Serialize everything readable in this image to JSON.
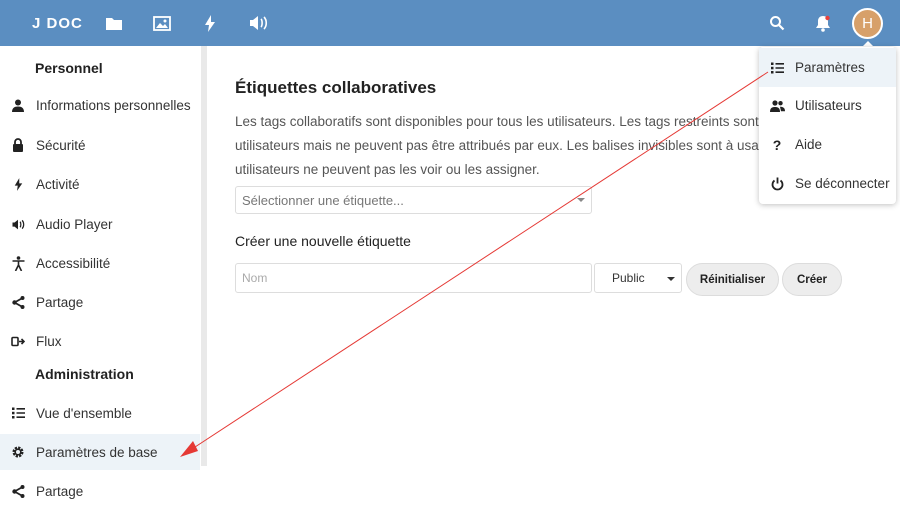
{
  "header": {
    "logo": "J DOC",
    "avatar_letter": "H",
    "icons": [
      "folder-icon",
      "image-icon",
      "bolt-icon",
      "volume-icon",
      "search-icon",
      "bell-icon"
    ]
  },
  "sidebar": {
    "personal_heading": "Personnel",
    "personal_items": [
      {
        "label": "Informations personnelles",
        "icon": "person-icon"
      },
      {
        "label": "Sécurité",
        "icon": "lock-icon"
      },
      {
        "label": "Activité",
        "icon": "bolt-icon"
      },
      {
        "label": "Audio Player",
        "icon": "volume-icon"
      },
      {
        "label": "Accessibilité",
        "icon": "accessibility-icon"
      },
      {
        "label": "Partage",
        "icon": "share-icon"
      },
      {
        "label": "Flux",
        "icon": "feed-icon"
      }
    ],
    "admin_heading": "Administration",
    "admin_items": [
      {
        "label": "Vue d'ensemble",
        "icon": "list-icon"
      },
      {
        "label": "Paramètres de base",
        "icon": "gear-icon"
      },
      {
        "label": "Partage",
        "icon": "share-icon"
      }
    ]
  },
  "main": {
    "title": "Étiquettes collaboratives",
    "description": "Les tags collaboratifs sont disponibles pour tous les utilisateurs. Les tags restreints sont vi utilisateurs mais ne peuvent pas être attribués par eux. Les balises invisibles sont à usage utilisateurs ne peuvent pas les voir ou les assigner.",
    "select_placeholder": "Sélectionner une étiquette...",
    "create_heading": "Créer une nouvelle étiquette",
    "name_placeholder": "Nom",
    "visibility_value": "Public",
    "reset_label": "Réinitialiser",
    "create_label": "Créer"
  },
  "menu": {
    "items": [
      {
        "label": "Paramètres",
        "icon": "list-icon"
      },
      {
        "label": "Utilisateurs",
        "icon": "users-icon"
      },
      {
        "label": "Aide",
        "icon": "help-icon"
      },
      {
        "label": "Se déconnecter",
        "icon": "power-icon"
      }
    ]
  },
  "colors": {
    "header": "#5b8ec1",
    "active_bg": "#edf3f8",
    "annotation_arrow": "#e53935",
    "avatar": "#d7a06a"
  }
}
